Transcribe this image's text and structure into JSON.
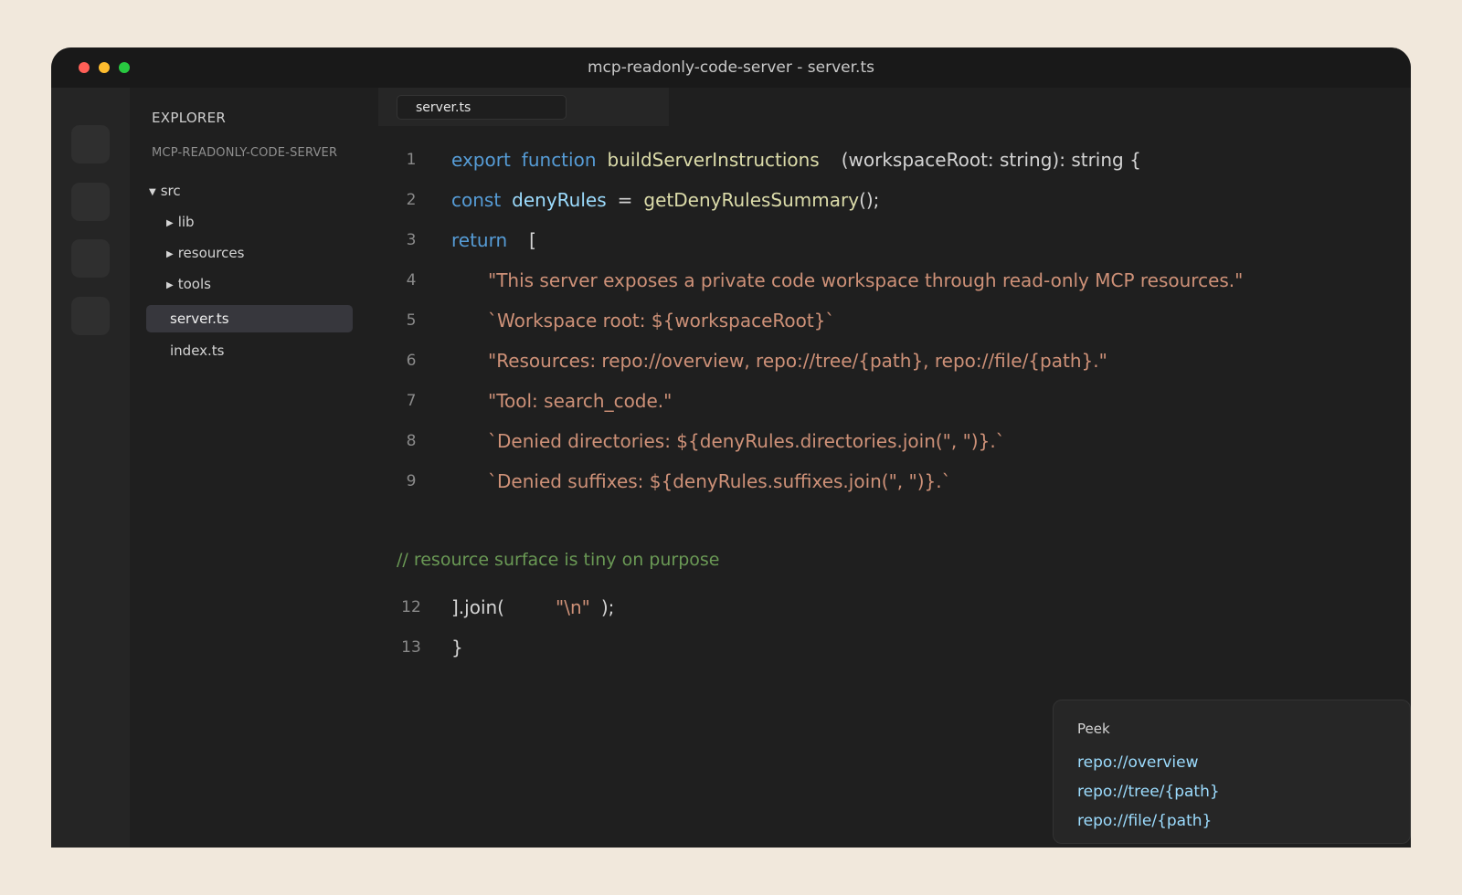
{
  "window": {
    "title": "mcp-readonly-code-server - server.ts"
  },
  "explorer": {
    "title": "EXPLORER",
    "project": "MCP-READONLY-CODE-SERVER",
    "folders": [
      {
        "label": "src",
        "expanded": true
      },
      {
        "label": "lib",
        "expanded": false
      },
      {
        "label": "resources",
        "expanded": false
      },
      {
        "label": "tools",
        "expanded": false
      }
    ],
    "files": [
      {
        "label": "server.ts",
        "active": true
      },
      {
        "label": "index.ts",
        "active": false
      }
    ]
  },
  "editor": {
    "tab": "server.ts",
    "lines": [
      {
        "n": "1",
        "kw1": "export",
        "kw2": "function",
        "fn": "buildServerInstructions",
        "rest": "(workspaceRoot: string): string {"
      },
      {
        "n": "2",
        "kw": "const",
        "var": "denyRules",
        "op": "=",
        "fn": "getDenyRulesSummary",
        "rest": "();"
      },
      {
        "n": "3",
        "kw": "return",
        "rest": "["
      },
      {
        "n": "4",
        "str": "\"This server exposes a private code workspace through read-only MCP resources.\""
      },
      {
        "n": "5",
        "str": "`Workspace root: ${workspaceRoot}`"
      },
      {
        "n": "6",
        "str": "\"Resources: repo://overview, repo://tree/{path}, repo://file/{path}.\""
      },
      {
        "n": "7",
        "str": "\"Tool: search_code.\""
      },
      {
        "n": "8",
        "str": "`Denied directories: ${denyRules.directories.join(\", \")}.`"
      },
      {
        "n": "9",
        "str": "`Denied suffixes: ${denyRules.suffixes.join(\", \")}.`"
      },
      {
        "n": "12",
        "pre": "].join(",
        "str": "\"\\n\"",
        "post": ");"
      },
      {
        "n": "13",
        "rest": "}"
      }
    ],
    "comment": "// resource surface is tiny on purpose"
  },
  "peek": {
    "title": "Peek",
    "links": [
      "repo://overview",
      "repo://tree/{path}",
      "repo://file/{path}"
    ]
  },
  "colors": {
    "keyword": "#569cd6",
    "function": "#dcdcaa",
    "variable": "#9cdcfe",
    "string": "#ce9178",
    "comment": "#6a9955"
  }
}
